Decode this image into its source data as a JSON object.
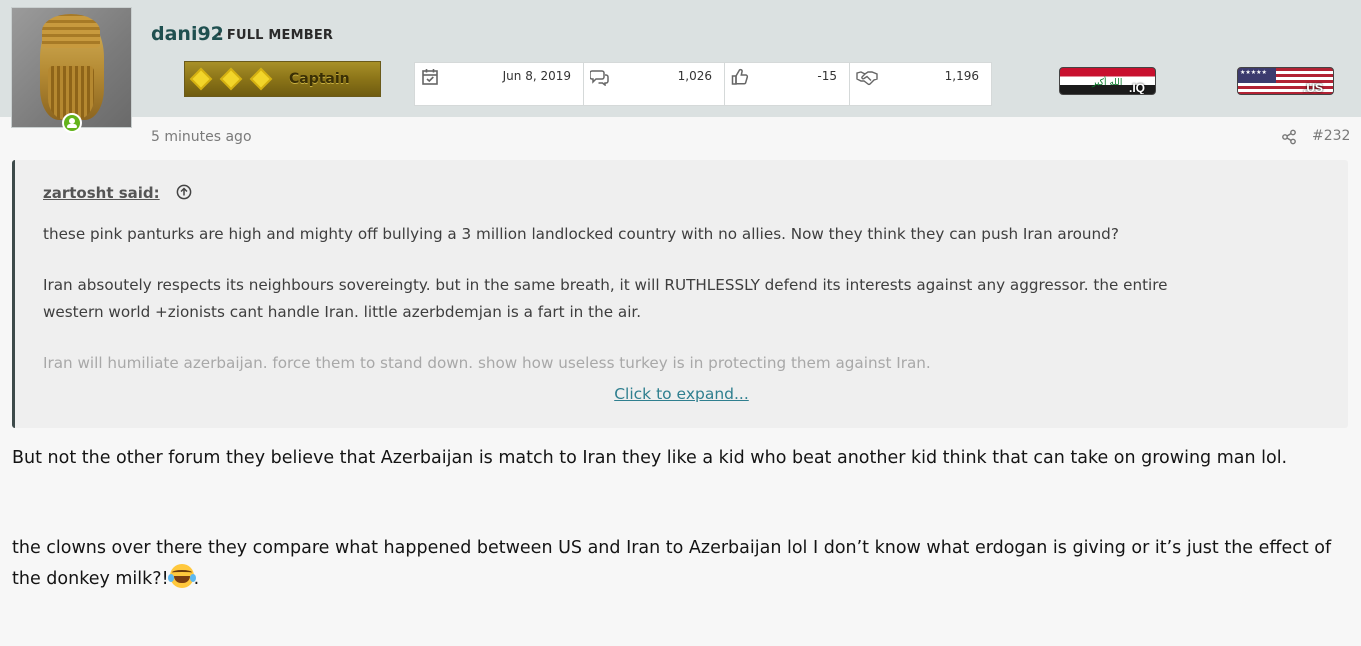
{
  "user": {
    "username": "dani92",
    "title": "· FULL MEMBER",
    "rank": "Captain",
    "online": true
  },
  "stats": [
    {
      "icon": "calendar-check-icon",
      "value": "Jun 8, 2019"
    },
    {
      "icon": "messages-icon",
      "value": "1,026"
    },
    {
      "icon": "thumbs-up-icon",
      "value": "-15"
    },
    {
      "icon": "handshake-icon",
      "value": "1,196"
    }
  ],
  "flags": [
    {
      "code": ".IQ",
      "script": "الله أكبر"
    },
    {
      "code": ".US"
    }
  ],
  "post": {
    "time": "5 minutes ago",
    "number": "#232"
  },
  "quote": {
    "author": "zartosht said:",
    "lines": [
      "these pink panturks are high and mighty off bullying a 3 million landlocked country with no allies. Now they think they can push Iran around?",
      "Iran absoutely respects its neighbours sovereingty. but in the same breath, it will RUTHLESSLY defend its interests against any aggressor. the entire",
      "western world +zionists cant handle Iran. little azerbdemjan is a fart in the air.",
      "Iran will humiliate azerbaijan. force them to stand down. show how useless turkey is in protecting them against Iran."
    ],
    "expand_label": "Click to expand..."
  },
  "body": {
    "paragraph1": "But not the other forum they believe that Azerbaijan is match to Iran they like a kid who beat another kid think that can take on growing man lol.",
    "paragraph2": "the clowns over there they compare what happened between US and Iran to Azerbaijan lol I don’t know what erdogan is giving or it’s just the effect of the donkey milk?!",
    "paragraph2_end": "."
  },
  "colors": {
    "header_band": "#dbe1e1",
    "username": "#1f5050",
    "link": "#2f7f8f",
    "online": "#63b31b"
  }
}
